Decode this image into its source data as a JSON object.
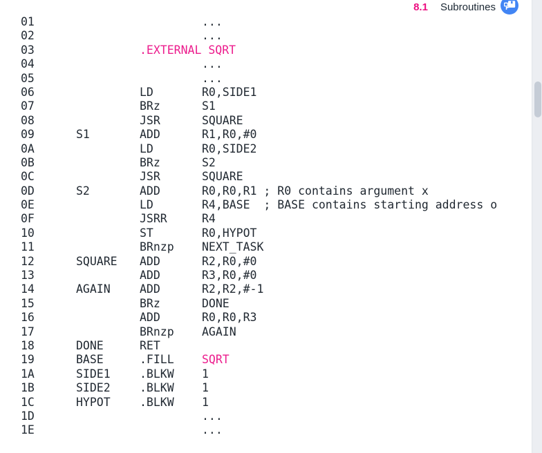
{
  "header": {
    "section_number": "8.1",
    "section_title": "Subroutines",
    "badge_icon": "bookmark-return-icon",
    "accent_color": "#ec0f81",
    "badge_color": "#4285f4"
  },
  "code_listing": {
    "accent_color": "#ec1d8d",
    "columns": [
      "address",
      "label",
      "opcode",
      "operand"
    ],
    "rows": [
      {
        "address": "01",
        "label": "",
        "opcode": "",
        "operand": "...",
        "accent": false
      },
      {
        "address": "02",
        "label": "",
        "opcode": "",
        "operand": "...",
        "accent": false
      },
      {
        "address": "03",
        "label": "",
        "opcode": ".EXTERNAL SQRT",
        "operand": "",
        "accent": true
      },
      {
        "address": "04",
        "label": "",
        "opcode": "",
        "operand": "...",
        "accent": false
      },
      {
        "address": "05",
        "label": "",
        "opcode": "",
        "operand": "...",
        "accent": false
      },
      {
        "address": "06",
        "label": "",
        "opcode": "LD",
        "operand": "R0,SIDE1",
        "accent": false
      },
      {
        "address": "07",
        "label": "",
        "opcode": "BRz",
        "operand": "S1",
        "accent": false
      },
      {
        "address": "08",
        "label": "",
        "opcode": "JSR",
        "operand": "SQUARE",
        "accent": false
      },
      {
        "address": "09",
        "label": "S1",
        "opcode": "ADD",
        "operand": "R1,R0,#0",
        "accent": false
      },
      {
        "address": "0A",
        "label": "",
        "opcode": "LD",
        "operand": "R0,SIDE2",
        "accent": false
      },
      {
        "address": "0B",
        "label": "",
        "opcode": "BRz",
        "operand": "S2",
        "accent": false
      },
      {
        "address": "0C",
        "label": "",
        "opcode": "JSR",
        "operand": "SQUARE",
        "accent": false
      },
      {
        "address": "0D",
        "label": "S2",
        "opcode": "ADD",
        "operand": "R0,R0,R1 ; R0 contains argument x",
        "accent": false
      },
      {
        "address": "0E",
        "label": "",
        "opcode": "LD",
        "operand": "R4,BASE  ; BASE contains starting address o",
        "accent": false
      },
      {
        "address": "0F",
        "label": "",
        "opcode": "JSRR",
        "operand": "R4",
        "accent": false
      },
      {
        "address": "10",
        "label": "",
        "opcode": "ST",
        "operand": "R0,HYPOT",
        "accent": false
      },
      {
        "address": "11",
        "label": "",
        "opcode": "BRnzp",
        "operand": "NEXT_TASK",
        "accent": false
      },
      {
        "address": "12",
        "label": "SQUARE",
        "opcode": "ADD",
        "operand": "R2,R0,#0",
        "accent": false
      },
      {
        "address": "13",
        "label": "",
        "opcode": "ADD",
        "operand": "R3,R0,#0",
        "accent": false
      },
      {
        "address": "14",
        "label": "AGAIN",
        "opcode": "ADD",
        "operand": "R2,R2,#-1",
        "accent": false
      },
      {
        "address": "15",
        "label": "",
        "opcode": "BRz",
        "operand": "DONE",
        "accent": false
      },
      {
        "address": "16",
        "label": "",
        "opcode": "ADD",
        "operand": "R0,R0,R3",
        "accent": false
      },
      {
        "address": "17",
        "label": "",
        "opcode": "BRnzp",
        "operand": "AGAIN",
        "accent": false
      },
      {
        "address": "18",
        "label": "DONE",
        "opcode": "RET",
        "operand": "",
        "accent": false
      },
      {
        "address": "19",
        "label": "BASE",
        "opcode": ".FILL",
        "operand": "SQRT",
        "accent_operand": true,
        "accent": false
      },
      {
        "address": "1A",
        "label": "SIDE1",
        "opcode": ".BLKW",
        "operand": "1",
        "accent": false
      },
      {
        "address": "1B",
        "label": "SIDE2",
        "opcode": ".BLKW",
        "operand": "1",
        "accent": false
      },
      {
        "address": "1C",
        "label": "HYPOT",
        "opcode": ".BLKW",
        "operand": "1",
        "accent": false
      },
      {
        "address": "1D",
        "label": "",
        "opcode": "",
        "operand": "...",
        "accent": false
      },
      {
        "address": "1E",
        "label": "",
        "opcode": "",
        "operand": "...",
        "accent": false
      }
    ]
  },
  "scrollbar": {
    "orientation": "vertical",
    "track_color": "#eceef2",
    "thumb_color": "#c5ccd6"
  }
}
